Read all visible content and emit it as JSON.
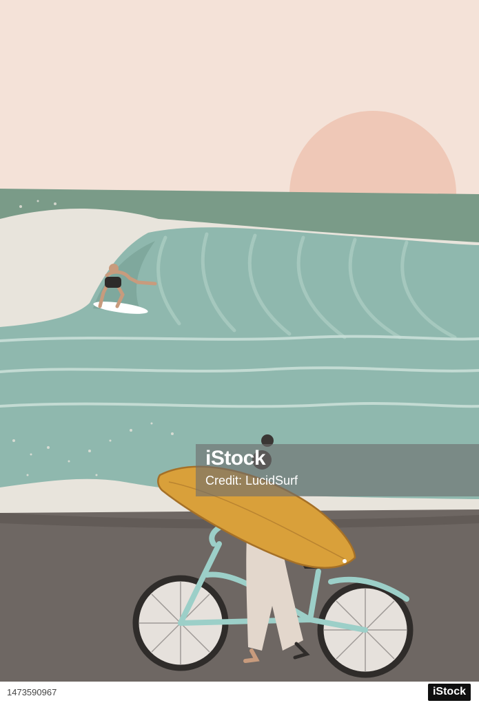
{
  "watermark": {
    "logo_text": "iStock",
    "credit_text": "Credit: LucidSurf"
  },
  "footer": {
    "image_id": "1473590967",
    "brand_text": "iStock"
  },
  "palette": {
    "sky": "#f4e2d8",
    "sun": "#efc8b7",
    "sea_back": "#7a9b88",
    "wave_main": "#8fb8ae",
    "wave_foam": "#e8e4dc",
    "sand": "#6e6763",
    "surfboard": "#d9a03a",
    "bicycle": "#9ccfc8"
  },
  "scene": {
    "subjects": [
      "sun-icon",
      "surfer-icon",
      "woman-icon",
      "surfboard-icon",
      "bicycle-icon"
    ]
  }
}
